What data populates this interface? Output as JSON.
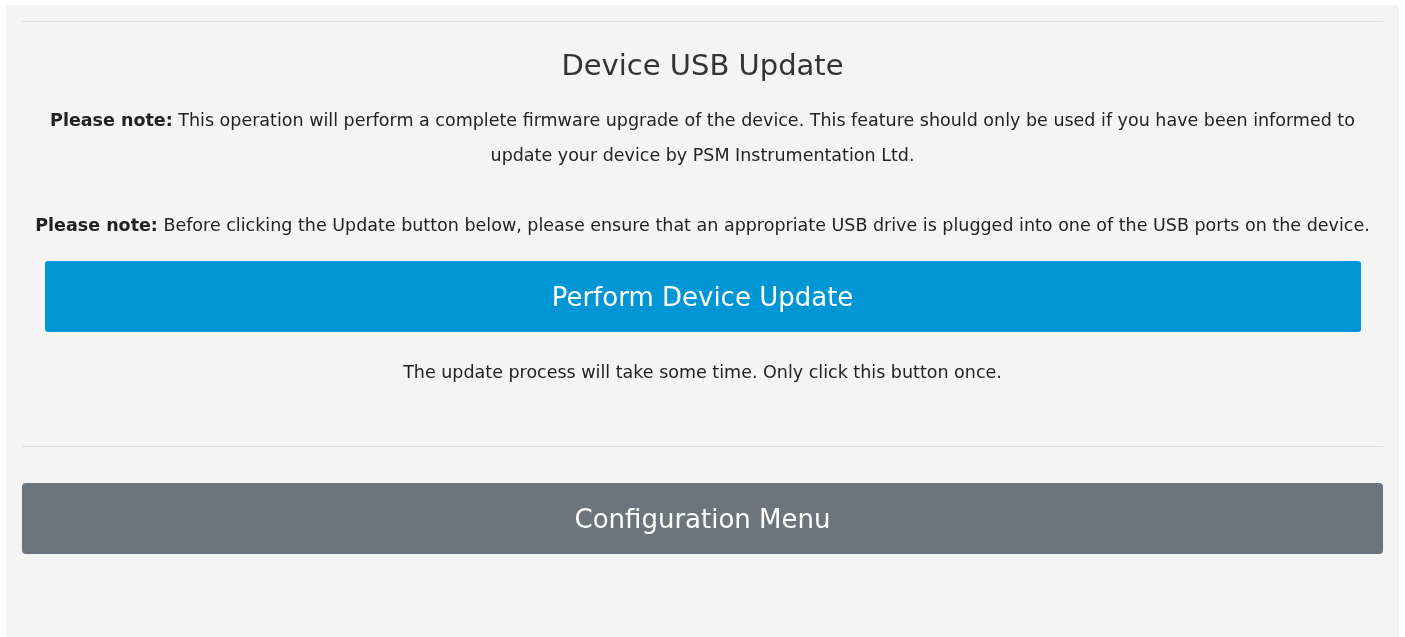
{
  "title": "Device USB Update",
  "notes": [
    "**Please note:** This operation will perform a complete firmware upgrade of the device. This feature should only be used if you have been informed to update your device by PSM Instrumentation Ltd.",
    "**Please note:** Before clicking the Update button below, please ensure that an appropriate USB drive is plugged into one of the USB ports on the device."
  ],
  "update_button": "Perform Device Update",
  "hint": "The update process will take some time. Only click this button once.",
  "menu_button": "Configuration Menu"
}
